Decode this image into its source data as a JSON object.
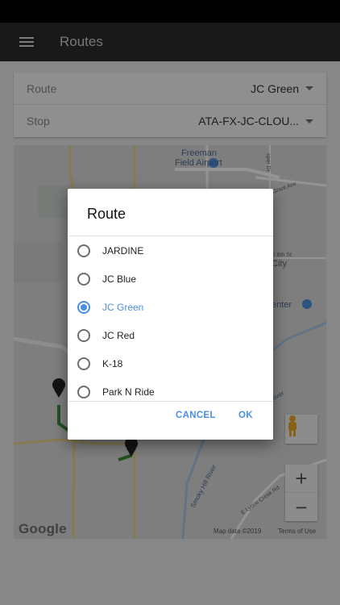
{
  "app_bar": {
    "title": "Routes"
  },
  "selectors": {
    "route_label": "Route",
    "route_value": "JC Green",
    "stop_label": "Stop",
    "stop_value": "ATA-FX-JC-CLOU..."
  },
  "map": {
    "labels": {
      "airport_line1": "Freeman",
      "airport_line2": "Field Airport",
      "grant_ave": "Grant Ave",
      "e_8th": "E 8th St",
      "city": "City",
      "center": "enter",
      "river": "River",
      "smoky_hill": "Smoky Hill River",
      "lyons_creek": "E Lyons Creek Rd",
      "rd_vertical": "sper Dr"
    },
    "google_logo": "Google",
    "map_data": "Map data ©2019",
    "terms": "Terms of Use",
    "zoom_in": "+",
    "zoom_out": "−"
  },
  "dialog": {
    "title": "Route",
    "options": [
      {
        "label": "JARDINE",
        "selected": false
      },
      {
        "label": "JC Blue",
        "selected": false
      },
      {
        "label": "JC Green",
        "selected": true
      },
      {
        "label": "JC Red",
        "selected": false
      },
      {
        "label": "K-18",
        "selected": false
      },
      {
        "label": "Park N Ride",
        "selected": false
      }
    ],
    "cancel_label": "CANCEL",
    "ok_label": "OK"
  },
  "colors": {
    "accent": "#4a8fe0",
    "app_bar": "#2b2b2b",
    "route_line": "#3c8c3c"
  }
}
